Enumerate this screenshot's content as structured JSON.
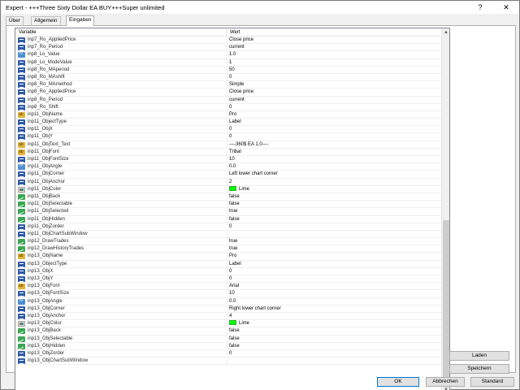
{
  "window": {
    "title": "Expert - +++Three Sixty Dollar EA BUY+++Super unlimited",
    "help_label": "?",
    "close_label": "✕"
  },
  "tabs": [
    {
      "label": "Über"
    },
    {
      "label": "Allgemein"
    },
    {
      "label": "Eingaben"
    }
  ],
  "grid": {
    "col_variable": "Variable",
    "col_value": "Wert",
    "scroll_up": "▲",
    "scroll_down": "▼",
    "rows": [
      {
        "name": "inp7_Ro_AppliedPrice",
        "value": "Close price",
        "icon": "int"
      },
      {
        "name": "inp7_Ro_Period",
        "value": "current",
        "icon": "int"
      },
      {
        "name": "inp8_Lo_Value",
        "value": "1.0",
        "icon": "dbl"
      },
      {
        "name": "inp8_Lo_ModeValue",
        "value": "1",
        "icon": "int"
      },
      {
        "name": "inp8_Ro_MAperiod",
        "value": "50",
        "icon": "int"
      },
      {
        "name": "inp8_Ro_MAshift",
        "value": "0",
        "icon": "int"
      },
      {
        "name": "inp8_Ro_MAmethod",
        "value": "Simple",
        "icon": "int"
      },
      {
        "name": "inp8_Ro_AppliedPrice",
        "value": "Close price",
        "icon": "int"
      },
      {
        "name": "inp8_Ro_Period",
        "value": "current",
        "icon": "int"
      },
      {
        "name": "inp8_Ro_Shift",
        "value": "0",
        "icon": "int"
      },
      {
        "name": "inp11_ObjName",
        "value": "Pro",
        "icon": "str"
      },
      {
        "name": "inp11_ObjectType",
        "value": "Label",
        "icon": "int"
      },
      {
        "name": "inp11_ObjX",
        "value": "0",
        "icon": "int"
      },
      {
        "name": "inp11_ObjY",
        "value": "0",
        "icon": "int"
      },
      {
        "name": "inp11_ObjText_Text",
        "value": "----360$ EA 1.0----",
        "icon": "str"
      },
      {
        "name": "inp11_ObjFont",
        "value": "Tribal",
        "icon": "str"
      },
      {
        "name": "inp11_ObjFontSize",
        "value": "10",
        "icon": "int"
      },
      {
        "name": "inp11_ObjAngle",
        "value": "0.0",
        "icon": "dbl"
      },
      {
        "name": "inp11_ObjCorner",
        "value": "Left lower chart corner",
        "icon": "int"
      },
      {
        "name": "inp11_ObjAnchor",
        "value": "2",
        "icon": "int"
      },
      {
        "name": "inp11_ObjColor",
        "value": "Lime",
        "icon": "color",
        "swatch": true
      },
      {
        "name": "inp11_ObjBack",
        "value": "false",
        "icon": "bool"
      },
      {
        "name": "inp11_ObjSelectable",
        "value": "false",
        "icon": "bool"
      },
      {
        "name": "inp11_ObjSelected",
        "value": "true",
        "icon": "bool"
      },
      {
        "name": "inp11_ObjHidden",
        "value": "false",
        "icon": "bool"
      },
      {
        "name": "inp11_ObjZorder",
        "value": "0",
        "icon": "int"
      },
      {
        "name": "inp11_ObjChartSubWindow",
        "value": "",
        "icon": "int"
      },
      {
        "name": "inp12_DrawTrades",
        "value": "true",
        "icon": "bool"
      },
      {
        "name": "inp12_DrawHistoryTrades",
        "value": "true",
        "icon": "bool"
      },
      {
        "name": "inp13_ObjName",
        "value": "Pro",
        "icon": "str"
      },
      {
        "name": "inp13_ObjectType",
        "value": "Label",
        "icon": "int"
      },
      {
        "name": "inp13_ObjX",
        "value": "0",
        "icon": "int"
      },
      {
        "name": "inp13_ObjY",
        "value": "0",
        "icon": "int"
      },
      {
        "name": "inp13_ObjFont",
        "value": "Arial",
        "icon": "str"
      },
      {
        "name": "inp13_ObjFontSize",
        "value": "10",
        "icon": "int"
      },
      {
        "name": "inp13_ObjAngle",
        "value": "0.0",
        "icon": "dbl"
      },
      {
        "name": "inp13_ObjCorner",
        "value": "Right lower chart corner",
        "icon": "int"
      },
      {
        "name": "inp13_ObjAnchor",
        "value": "4",
        "icon": "int"
      },
      {
        "name": "inp13_ObjColor",
        "value": "Lime",
        "icon": "color",
        "swatch": true
      },
      {
        "name": "inp13_ObjBack",
        "value": "false",
        "icon": "bool"
      },
      {
        "name": "inp13_ObjSelectable",
        "value": "false",
        "icon": "bool"
      },
      {
        "name": "inp13_ObjHidden",
        "value": "false",
        "icon": "bool"
      },
      {
        "name": "inp13_ObjZorder",
        "value": "0",
        "icon": "int"
      },
      {
        "name": "inp13_ObjChartSubWindow",
        "value": "",
        "icon": "int"
      }
    ]
  },
  "side_buttons": {
    "load_label": "Laden",
    "save_label": "Speichern"
  },
  "footer": {
    "ok_label": "OK",
    "cancel_label": "Abbrechen",
    "default_label": "Standard"
  },
  "colors": {
    "lime": "#00ff00",
    "accent": "#0078d7"
  }
}
